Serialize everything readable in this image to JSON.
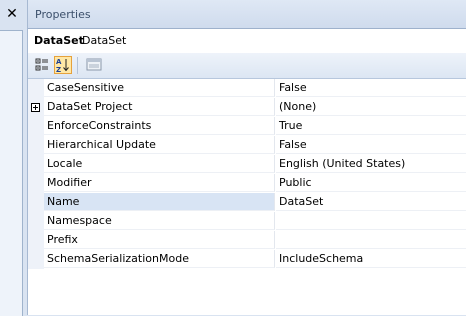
{
  "left_panel": {
    "close_glyph": "✕"
  },
  "properties_panel": {
    "title": "Properties",
    "object_selector": {
      "name": "DataSet",
      "type": "DataSet"
    },
    "toolbar": {
      "categorized_icon": "categorized-icon",
      "alphabetical_icon": "alphabetical-icon",
      "property_pages_icon": "property-pages-icon"
    },
    "properties": [
      {
        "name": "CaseSensitive",
        "value": "False",
        "expandable": false
      },
      {
        "name": "DataSet Project",
        "value": "(None)",
        "expandable": true
      },
      {
        "name": "EnforceConstraints",
        "value": "True",
        "expandable": false
      },
      {
        "name": "Hierarchical Update",
        "value": "False",
        "expandable": false
      },
      {
        "name": "Locale",
        "value": "English (United States)",
        "expandable": false
      },
      {
        "name": "Modifier",
        "value": "Public",
        "expandable": false
      },
      {
        "name": "Name",
        "value": "DataSet",
        "expandable": false,
        "selected": true
      },
      {
        "name": "Namespace",
        "value": "",
        "expandable": false
      },
      {
        "name": "Prefix",
        "value": "",
        "expandable": false
      },
      {
        "name": "SchemaSerializationMode",
        "value": "IncludeSchema",
        "expandable": false
      }
    ]
  }
}
